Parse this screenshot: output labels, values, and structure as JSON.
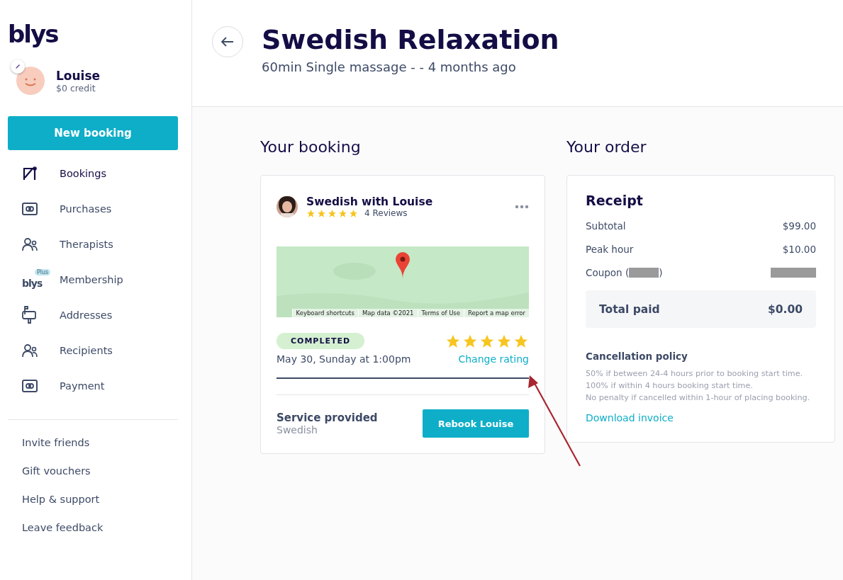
{
  "sidebar": {
    "logo": "blys",
    "user": {
      "name": "Louise",
      "credit": "$0 credit"
    },
    "new_booking": "New booking",
    "items": [
      {
        "label": "Bookings",
        "kind": "bookings",
        "selected": true
      },
      {
        "label": "Purchases",
        "kind": "card",
        "selected": false
      },
      {
        "label": "Therapists",
        "kind": "people",
        "selected": false
      },
      {
        "label": "Membership",
        "kind": "plus",
        "selected": false,
        "logo": "blys",
        "tag": "Plus"
      },
      {
        "label": "Addresses",
        "kind": "mailbox",
        "selected": false
      },
      {
        "label": "Recipients",
        "kind": "people",
        "selected": false
      },
      {
        "label": "Payment",
        "kind": "card",
        "selected": false
      }
    ],
    "links": [
      "Invite friends",
      "Gift vouchers",
      "Help & support",
      "Leave feedback"
    ]
  },
  "header": {
    "title": "Swedish Relaxation",
    "subtitle": "60min Single massage - - 4 months ago"
  },
  "booking": {
    "heading": "Your booking",
    "therapist": "Swedish with Louise",
    "stars": 5,
    "reviews": "4 Reviews",
    "map_links": [
      "Keyboard shortcuts",
      "Map data ©2021",
      "Terms of Use",
      "Report a map error"
    ],
    "status": "COMPLETED",
    "date": "May 30, Sunday at 1:00pm",
    "rating": {
      "stars": 5
    },
    "change_rating": "Change rating",
    "service_label": "Service provided",
    "service": "Swedish",
    "rebook": "Rebook Louise"
  },
  "order": {
    "heading": "Your order",
    "receipt": "Receipt",
    "lines": [
      {
        "label": "Subtotal",
        "value": "$99.00",
        "kind": "plain"
      },
      {
        "label": "Peak hour",
        "value": "$10.00",
        "kind": "plain"
      },
      {
        "label": "Coupon (",
        "suffix": ")",
        "kind": "redacted"
      }
    ],
    "total_label": "Total paid",
    "total": "$0.00",
    "policy_title": "Cancellation policy",
    "policy_lines": [
      "50% if between 24-4 hours prior to booking start time.",
      "100% if within 4 hours booking start time.",
      "No penalty if cancelled within 1-hour of placing booking."
    ],
    "download": "Download invoice"
  }
}
